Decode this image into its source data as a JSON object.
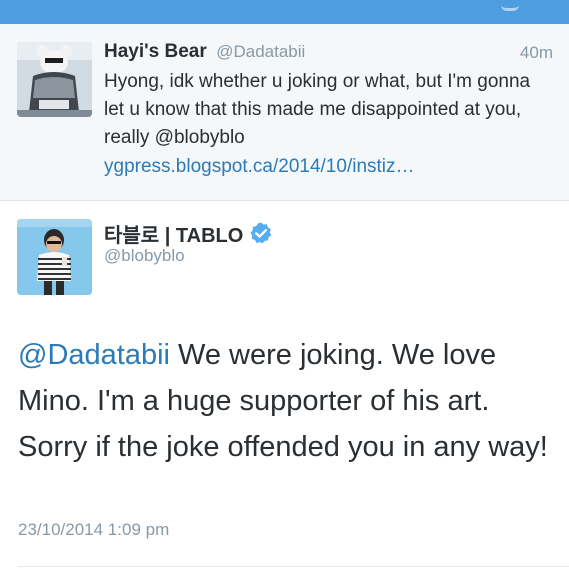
{
  "reply_tweet": {
    "display_name": "Hayi's Bear",
    "handle": "@Dadatabii",
    "time_ago": "40m",
    "body": "Hyong, idk whether u joking or what, but I'm gonna let u know that this made me disappointed at you, really @blobyblo",
    "link": "ygpress.blogspot.ca/2014/10/instiz…"
  },
  "main_tweet": {
    "display_name": "타블로 | TABLO",
    "handle": "@blobyblo",
    "mention": "@Dadatabii",
    "body": " We were joking. We love Mino. I'm a huge supporter of his art. Sorry if the joke offended you in any way!",
    "timestamp": "23/10/2014 1:09 pm"
  },
  "icons": {
    "verified": "verified-badge-icon"
  },
  "colors": {
    "accent": "#4d9ee0",
    "link": "#2b7bb9",
    "text": "#292f33",
    "muted": "#8899a6",
    "reply_background": "#f5f8fa"
  }
}
